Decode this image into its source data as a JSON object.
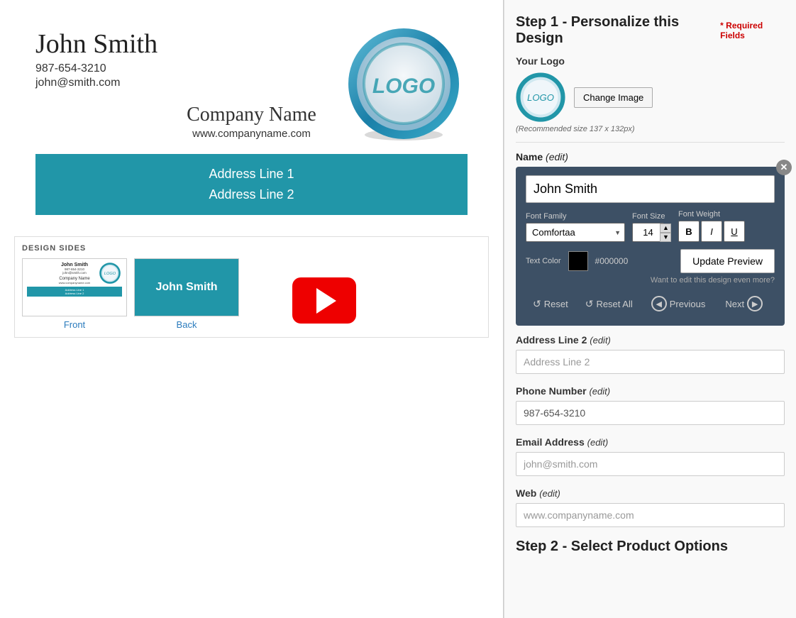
{
  "preview": {
    "name": "John Smith",
    "phone": "987-654-3210",
    "email": "john@smith.com",
    "company_name": "Company Name",
    "website": "www.companyname.com",
    "address_line1": "Address Line 1",
    "address_line2": "Address Line 2",
    "design_sides_label": "DESIGN SIDES",
    "front_label": "Front",
    "back_label": "Back",
    "back_text": "John Smith"
  },
  "right_panel": {
    "step1_title": "Step 1 - Personalize this Design",
    "required_fields": "* Required Fields",
    "your_logo_label": "Your Logo",
    "change_image_btn": "Change Image",
    "logo_recommendation": "(Recommended size 137 x 132px)",
    "name_label": "Name",
    "edit_label": "(edit)",
    "name_value": "John Smith",
    "font_family_label": "Font Family",
    "font_size_label": "Font Size",
    "font_weight_label": "Font Weight",
    "font_family_value": "Comfortaa",
    "font_size_value": "14",
    "bold_label": "B",
    "italic_label": "I",
    "underline_label": "U",
    "text_color_label": "Text Color",
    "color_hex": "#000000",
    "update_preview_btn": "Update Preview",
    "want_edit_text": "Want to edit this design even more?",
    "reset_label": "Reset",
    "reset_all_label": "Reset All",
    "previous_label": "Previous",
    "next_label": "Next",
    "address2_label": "Address Line 2",
    "address2_edit": "(edit)",
    "address2_placeholder": "Address Line 2",
    "phone_label": "Phone Number",
    "phone_edit": "(edit)",
    "phone_value": "987-654-3210",
    "email_label": "Email Address",
    "email_edit": "(edit)",
    "email_placeholder": "john@smith.com",
    "web_label": "Web",
    "web_edit": "(edit)",
    "web_placeholder": "www.companyname.com",
    "step2_title": "Step 2 - Select Product Options"
  }
}
